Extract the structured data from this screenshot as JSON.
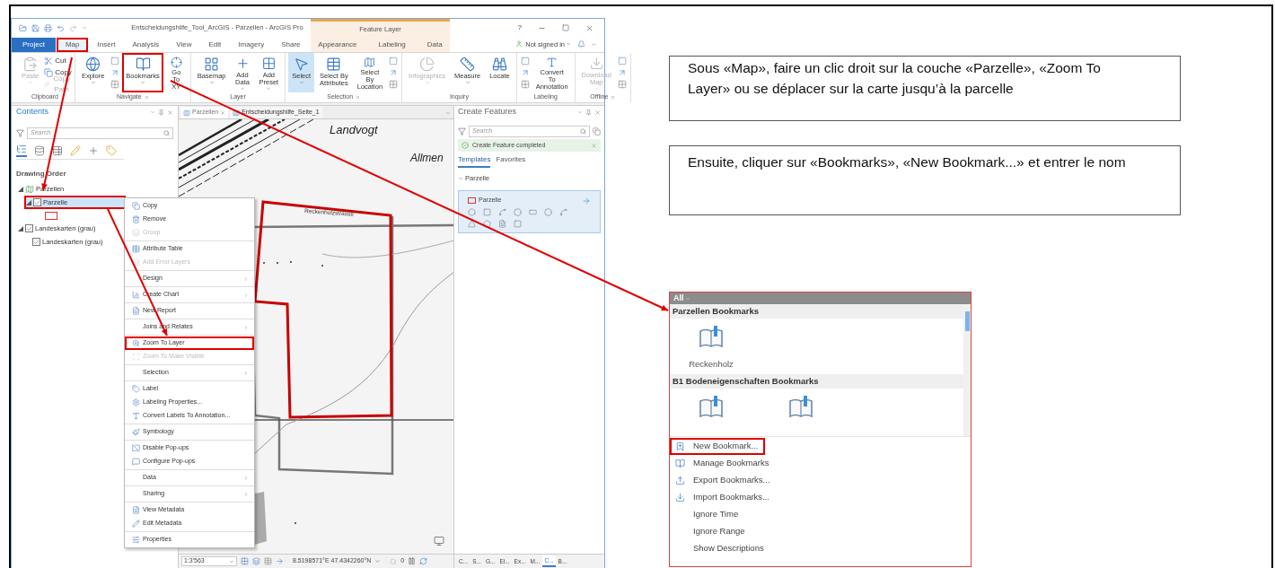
{
  "window": {
    "title": "Entscheidungshilfe_Tool_ArcGIS - Parzellen - ArcGIS Pro",
    "contextual_group": "Feature Layer",
    "help": "?"
  },
  "ribbon_tabs": [
    {
      "label": "Project",
      "kind": "file",
      "selected": false,
      "highlighted": false
    },
    {
      "label": "Map",
      "kind": "tab",
      "selected": true,
      "highlighted": true
    },
    {
      "label": "Insert",
      "kind": "tab",
      "selected": false,
      "highlighted": false
    },
    {
      "label": "Analysis",
      "kind": "tab",
      "selected": false,
      "highlighted": false
    },
    {
      "label": "View",
      "kind": "tab",
      "selected": false,
      "highlighted": false
    },
    {
      "label": "Edit",
      "kind": "tab",
      "selected": false,
      "highlighted": false
    },
    {
      "label": "Imagery",
      "kind": "tab",
      "selected": false,
      "highlighted": false
    },
    {
      "label": "Share",
      "kind": "tab",
      "selected": false,
      "highlighted": false
    },
    {
      "label": "Appearance",
      "kind": "contextual",
      "selected": false,
      "highlighted": false
    },
    {
      "label": "Labeling",
      "kind": "contextual",
      "selected": false,
      "highlighted": false
    },
    {
      "label": "Data",
      "kind": "contextual",
      "selected": false,
      "highlighted": false
    }
  ],
  "account": "Not signed in",
  "ribbon_groups": [
    {
      "label": "Clipboard",
      "launcher": false,
      "commands": [
        {
          "label": "Paste",
          "kind": "large",
          "disabled": true,
          "active": false,
          "highlighted": false,
          "dropdown": true
        },
        {
          "label": "Cut",
          "kind": "small",
          "disabled": false
        },
        {
          "label": "Copy",
          "kind": "small",
          "disabled": false
        },
        {
          "label": "Copy Path",
          "kind": "small",
          "disabled": true
        }
      ]
    },
    {
      "label": "Navigate",
      "launcher": true,
      "commands": [
        {
          "label": "Explore",
          "kind": "large",
          "disabled": false,
          "active": false,
          "highlighted": false,
          "dropdown": true
        },
        {
          "kind": "tools"
        },
        {
          "label": "Bookmarks",
          "kind": "large",
          "disabled": false,
          "active": false,
          "highlighted": true,
          "dropdown": true
        },
        {
          "label": "Go\nTo XY",
          "kind": "large",
          "disabled": false,
          "active": false,
          "highlighted": false,
          "dropdown": false
        }
      ]
    },
    {
      "label": "Layer",
      "launcher": false,
      "commands": [
        {
          "label": "Basemap",
          "kind": "large",
          "disabled": false,
          "active": false,
          "highlighted": false,
          "dropdown": true
        },
        {
          "label": "Add\nData",
          "kind": "large",
          "disabled": false,
          "active": false,
          "highlighted": false,
          "dropdown": true
        },
        {
          "label": "Add\nPreset",
          "kind": "large",
          "disabled": false,
          "active": false,
          "highlighted": false,
          "dropdown": true
        }
      ]
    },
    {
      "label": "Selection",
      "launcher": true,
      "commands": [
        {
          "label": "Select",
          "kind": "large",
          "disabled": false,
          "active": true,
          "highlighted": false,
          "dropdown": true
        },
        {
          "label": "Select By\nAttributes",
          "kind": "large",
          "disabled": false,
          "active": false,
          "highlighted": false,
          "dropdown": false
        },
        {
          "label": "Select By\nLocation",
          "kind": "large",
          "disabled": false,
          "active": false,
          "highlighted": false,
          "dropdown": false
        },
        {
          "kind": "tools"
        }
      ]
    },
    {
      "label": "Inquiry",
      "launcher": false,
      "commands": [
        {
          "label": "Infographics",
          "kind": "large",
          "disabled": true,
          "active": false,
          "highlighted": false,
          "dropdown": true
        },
        {
          "label": "Measure",
          "kind": "large",
          "disabled": false,
          "active": false,
          "highlighted": false,
          "dropdown": true
        },
        {
          "label": "Locate",
          "kind": "large",
          "disabled": false,
          "active": false,
          "highlighted": false,
          "dropdown": false
        }
      ]
    },
    {
      "label": "Labeling",
      "launcher": false,
      "commands": [
        {
          "kind": "tools"
        },
        {
          "label": "Convert To\nAnnotation",
          "kind": "large",
          "disabled": false,
          "active": false,
          "highlighted": false,
          "dropdown": false
        }
      ]
    },
    {
      "label": "Offline",
      "launcher": true,
      "commands": [
        {
          "label": "Download\nMap",
          "kind": "large",
          "disabled": true,
          "active": false,
          "highlighted": false,
          "dropdown": true
        },
        {
          "kind": "tools"
        }
      ]
    }
  ],
  "contents": {
    "title": "Contents",
    "search_placeholder": "Search",
    "heading": "Drawing Order",
    "layers": [
      {
        "label": "Parzellen",
        "kind": "map",
        "expanded": true,
        "children": [
          {
            "label": "Parzelle",
            "kind": "layer",
            "expanded": true,
            "checked": true,
            "selected": true,
            "highlighted": true,
            "children": [
              {
                "kind": "legend"
              }
            ]
          }
        ]
      },
      {
        "label": "Landeskarten (grau)",
        "kind": "layer",
        "expanded": true,
        "checked": true,
        "selected": false,
        "highlighted": false,
        "children": [
          {
            "label": "Landeskarten (grau)",
            "kind": "layer",
            "checked": true,
            "selected": false,
            "highlighted": false
          }
        ]
      }
    ]
  },
  "context_menu": {
    "sections": [
      [
        {
          "label": "Copy",
          "disabled": false,
          "submenu": false,
          "highlighted": false
        },
        {
          "label": "Remove",
          "disabled": false,
          "submenu": false,
          "highlighted": false
        },
        {
          "label": "Group",
          "disabled": true,
          "submenu": false,
          "highlighted": false
        }
      ],
      [
        {
          "label": "Attribute Table",
          "disabled": false,
          "submenu": false,
          "highlighted": false
        },
        {
          "label": "Add Error Layers",
          "disabled": true,
          "submenu": false,
          "highlighted": false
        }
      ],
      [
        {
          "label": "Design",
          "disabled": false,
          "submenu": true,
          "highlighted": false
        }
      ],
      [
        {
          "label": "Create Chart",
          "disabled": false,
          "submenu": true,
          "highlighted": false
        }
      ],
      [
        {
          "label": "New Report",
          "disabled": false,
          "submenu": false,
          "highlighted": false
        }
      ],
      [
        {
          "label": "Joins and Relates",
          "disabled": false,
          "submenu": true,
          "highlighted": false
        }
      ],
      [
        {
          "label": "Zoom To Layer",
          "disabled": false,
          "submenu": false,
          "highlighted": true
        },
        {
          "label": "Zoom To Make Visible",
          "disabled": true,
          "submenu": false,
          "highlighted": false
        }
      ],
      [
        {
          "label": "Selection",
          "disabled": false,
          "submenu": true,
          "highlighted": false
        }
      ],
      [
        {
          "label": "Label",
          "disabled": false,
          "submenu": false,
          "highlighted": false
        },
        {
          "label": "Labeling Properties...",
          "disabled": false,
          "submenu": false,
          "highlighted": false
        },
        {
          "label": "Convert Labels To Annotation...",
          "disabled": false,
          "submenu": false,
          "highlighted": false
        }
      ],
      [
        {
          "label": "Symbology",
          "disabled": false,
          "submenu": false,
          "highlighted": false
        }
      ],
      [
        {
          "label": "Disable Pop-ups",
          "disabled": false,
          "submenu": false,
          "highlighted": false
        },
        {
          "label": "Configure Pop-ups",
          "disabled": false,
          "submenu": false,
          "highlighted": false
        }
      ],
      [
        {
          "label": "Data",
          "disabled": false,
          "submenu": true,
          "highlighted": false
        }
      ],
      [
        {
          "label": "Sharing",
          "disabled": false,
          "submenu": true,
          "highlighted": false
        }
      ],
      [
        {
          "label": "View Metadata",
          "disabled": false,
          "submenu": false,
          "highlighted": false
        },
        {
          "label": "Edit Metadata",
          "disabled": false,
          "submenu": false,
          "highlighted": false
        }
      ],
      [
        {
          "label": "Properties",
          "disabled": false,
          "submenu": false,
          "highlighted": false
        }
      ]
    ]
  },
  "map_view": {
    "tabs": [
      {
        "label": "Parzellen",
        "selected": true,
        "closable": true
      },
      {
        "label": "Entscheidungshilfe_Seite_1",
        "selected": false,
        "closable": false
      }
    ],
    "labels": [
      "Landvogt",
      "Allmen",
      "Reckenholzstrasse"
    ],
    "status": {
      "scale": "1:3'563",
      "coordinates": "8.5198571°E 47.4342260°N",
      "selected_count": "0"
    }
  },
  "create_features": {
    "title": "Create Features",
    "search_placeholder": "Search",
    "message": "Create Feature completed",
    "tabs": [
      {
        "label": "Templates",
        "selected": true
      },
      {
        "label": "Favorites",
        "selected": false
      }
    ],
    "groups": [
      {
        "label": "Parzelle",
        "expanded": true,
        "templates": [
          {
            "label": "Parzelle",
            "selected": true
          }
        ]
      }
    ],
    "bottom_tabs": [
      {
        "label": "C...",
        "selected": false
      },
      {
        "label": "S...",
        "selected": false
      },
      {
        "label": "G...",
        "selected": false
      },
      {
        "label": "El...",
        "selected": false
      },
      {
        "label": "Ex...",
        "selected": false
      },
      {
        "label": "M...",
        "selected": false
      },
      {
        "label": "C...",
        "selected": true
      },
      {
        "label": "B...",
        "selected": false
      }
    ]
  },
  "notes": [
    "Sous «Map», faire un clic droit sur la couche «Parzelle», «Zoom To Layer» ou se déplacer sur la carte jusqu’à la parcelle",
    "Ensuite, cliquer sur «Bookmarks», «New Bookmark...» et entrer le nom"
  ],
  "bookmarks_popup": {
    "filter": "All",
    "sections": [
      {
        "title": "Parzellen Bookmarks",
        "bookmarks": [
          {
            "kind": "bookmark",
            "label": "Reckenholz"
          }
        ]
      },
      {
        "title": "B1 Bodeneigenschaften Bookmarks",
        "bookmarks": [
          {
            "kind": "bookmark"
          },
          {
            "kind": "bookmark"
          }
        ]
      }
    ],
    "menu": [
      {
        "label": "New Bookmark...",
        "highlighted": true
      },
      {
        "label": "Manage Bookmarks",
        "highlighted": false
      },
      {
        "label": "Export Bookmarks...",
        "highlighted": false
      },
      {
        "label": "Import Bookmarks...",
        "highlighted": false
      },
      {
        "label": "Ignore Time",
        "highlighted": false
      },
      {
        "label": "Ignore Range",
        "highlighted": false
      },
      {
        "label": "Show Descriptions",
        "highlighted": false
      }
    ]
  }
}
